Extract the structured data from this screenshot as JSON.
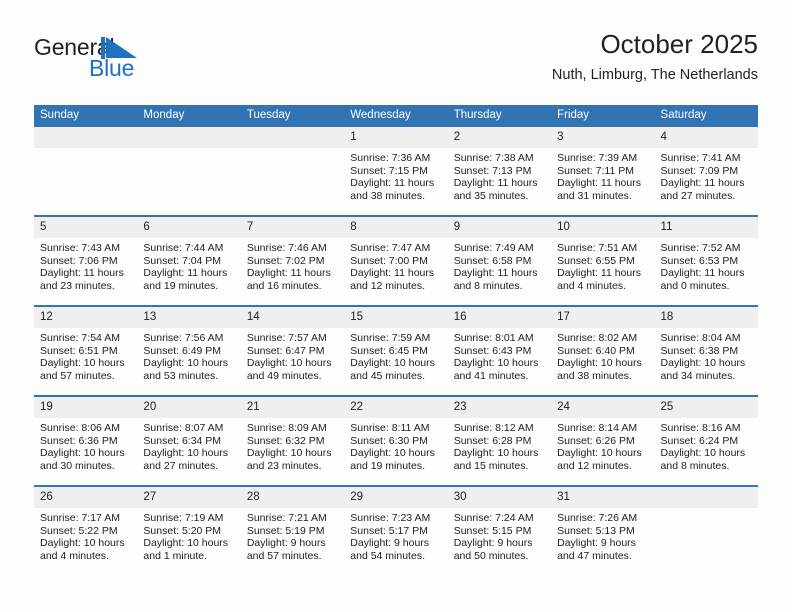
{
  "brand": {
    "name_line1": "General",
    "name_line2": "Blue",
    "flag_icon": "blue-triangle-flag-icon",
    "accent_color": "#1f72c0"
  },
  "header": {
    "title": "October 2025",
    "subtitle": "Nuth, Limburg, The Netherlands"
  },
  "theme": {
    "header_blue": "#3273b4",
    "day_number_bg": "#efefef",
    "page_bg": "#fdfdfd",
    "text": "#222222"
  },
  "weekday_headers": [
    "Sunday",
    "Monday",
    "Tuesday",
    "Wednesday",
    "Thursday",
    "Friday",
    "Saturday"
  ],
  "labels": {
    "sunrise_prefix": "Sunrise:",
    "sunset_prefix": "Sunset:",
    "daylight_prefix": "Daylight:"
  },
  "weeks": [
    [
      {
        "day": "",
        "sunrise": "",
        "sunset": "",
        "daylight": ""
      },
      {
        "day": "",
        "sunrise": "",
        "sunset": "",
        "daylight": ""
      },
      {
        "day": "",
        "sunrise": "",
        "sunset": "",
        "daylight": ""
      },
      {
        "day": "1",
        "sunrise": "Sunrise: 7:36 AM",
        "sunset": "Sunset: 7:15 PM",
        "daylight": "Daylight: 11 hours and 38 minutes."
      },
      {
        "day": "2",
        "sunrise": "Sunrise: 7:38 AM",
        "sunset": "Sunset: 7:13 PM",
        "daylight": "Daylight: 11 hours and 35 minutes."
      },
      {
        "day": "3",
        "sunrise": "Sunrise: 7:39 AM",
        "sunset": "Sunset: 7:11 PM",
        "daylight": "Daylight: 11 hours and 31 minutes."
      },
      {
        "day": "4",
        "sunrise": "Sunrise: 7:41 AM",
        "sunset": "Sunset: 7:09 PM",
        "daylight": "Daylight: 11 hours and 27 minutes."
      }
    ],
    [
      {
        "day": "5",
        "sunrise": "Sunrise: 7:43 AM",
        "sunset": "Sunset: 7:06 PM",
        "daylight": "Daylight: 11 hours and 23 minutes."
      },
      {
        "day": "6",
        "sunrise": "Sunrise: 7:44 AM",
        "sunset": "Sunset: 7:04 PM",
        "daylight": "Daylight: 11 hours and 19 minutes."
      },
      {
        "day": "7",
        "sunrise": "Sunrise: 7:46 AM",
        "sunset": "Sunset: 7:02 PM",
        "daylight": "Daylight: 11 hours and 16 minutes."
      },
      {
        "day": "8",
        "sunrise": "Sunrise: 7:47 AM",
        "sunset": "Sunset: 7:00 PM",
        "daylight": "Daylight: 11 hours and 12 minutes."
      },
      {
        "day": "9",
        "sunrise": "Sunrise: 7:49 AM",
        "sunset": "Sunset: 6:58 PM",
        "daylight": "Daylight: 11 hours and 8 minutes."
      },
      {
        "day": "10",
        "sunrise": "Sunrise: 7:51 AM",
        "sunset": "Sunset: 6:55 PM",
        "daylight": "Daylight: 11 hours and 4 minutes."
      },
      {
        "day": "11",
        "sunrise": "Sunrise: 7:52 AM",
        "sunset": "Sunset: 6:53 PM",
        "daylight": "Daylight: 11 hours and 0 minutes."
      }
    ],
    [
      {
        "day": "12",
        "sunrise": "Sunrise: 7:54 AM",
        "sunset": "Sunset: 6:51 PM",
        "daylight": "Daylight: 10 hours and 57 minutes."
      },
      {
        "day": "13",
        "sunrise": "Sunrise: 7:56 AM",
        "sunset": "Sunset: 6:49 PM",
        "daylight": "Daylight: 10 hours and 53 minutes."
      },
      {
        "day": "14",
        "sunrise": "Sunrise: 7:57 AM",
        "sunset": "Sunset: 6:47 PM",
        "daylight": "Daylight: 10 hours and 49 minutes."
      },
      {
        "day": "15",
        "sunrise": "Sunrise: 7:59 AM",
        "sunset": "Sunset: 6:45 PM",
        "daylight": "Daylight: 10 hours and 45 minutes."
      },
      {
        "day": "16",
        "sunrise": "Sunrise: 8:01 AM",
        "sunset": "Sunset: 6:43 PM",
        "daylight": "Daylight: 10 hours and 41 minutes."
      },
      {
        "day": "17",
        "sunrise": "Sunrise: 8:02 AM",
        "sunset": "Sunset: 6:40 PM",
        "daylight": "Daylight: 10 hours and 38 minutes."
      },
      {
        "day": "18",
        "sunrise": "Sunrise: 8:04 AM",
        "sunset": "Sunset: 6:38 PM",
        "daylight": "Daylight: 10 hours and 34 minutes."
      }
    ],
    [
      {
        "day": "19",
        "sunrise": "Sunrise: 8:06 AM",
        "sunset": "Sunset: 6:36 PM",
        "daylight": "Daylight: 10 hours and 30 minutes."
      },
      {
        "day": "20",
        "sunrise": "Sunrise: 8:07 AM",
        "sunset": "Sunset: 6:34 PM",
        "daylight": "Daylight: 10 hours and 27 minutes."
      },
      {
        "day": "21",
        "sunrise": "Sunrise: 8:09 AM",
        "sunset": "Sunset: 6:32 PM",
        "daylight": "Daylight: 10 hours and 23 minutes."
      },
      {
        "day": "22",
        "sunrise": "Sunrise: 8:11 AM",
        "sunset": "Sunset: 6:30 PM",
        "daylight": "Daylight: 10 hours and 19 minutes."
      },
      {
        "day": "23",
        "sunrise": "Sunrise: 8:12 AM",
        "sunset": "Sunset: 6:28 PM",
        "daylight": "Daylight: 10 hours and 15 minutes."
      },
      {
        "day": "24",
        "sunrise": "Sunrise: 8:14 AM",
        "sunset": "Sunset: 6:26 PM",
        "daylight": "Daylight: 10 hours and 12 minutes."
      },
      {
        "day": "25",
        "sunrise": "Sunrise: 8:16 AM",
        "sunset": "Sunset: 6:24 PM",
        "daylight": "Daylight: 10 hours and 8 minutes."
      }
    ],
    [
      {
        "day": "26",
        "sunrise": "Sunrise: 7:17 AM",
        "sunset": "Sunset: 5:22 PM",
        "daylight": "Daylight: 10 hours and 4 minutes."
      },
      {
        "day": "27",
        "sunrise": "Sunrise: 7:19 AM",
        "sunset": "Sunset: 5:20 PM",
        "daylight": "Daylight: 10 hours and 1 minute."
      },
      {
        "day": "28",
        "sunrise": "Sunrise: 7:21 AM",
        "sunset": "Sunset: 5:19 PM",
        "daylight": "Daylight: 9 hours and 57 minutes."
      },
      {
        "day": "29",
        "sunrise": "Sunrise: 7:23 AM",
        "sunset": "Sunset: 5:17 PM",
        "daylight": "Daylight: 9 hours and 54 minutes."
      },
      {
        "day": "30",
        "sunrise": "Sunrise: 7:24 AM",
        "sunset": "Sunset: 5:15 PM",
        "daylight": "Daylight: 9 hours and 50 minutes."
      },
      {
        "day": "31",
        "sunrise": "Sunrise: 7:26 AM",
        "sunset": "Sunset: 5:13 PM",
        "daylight": "Daylight: 9 hours and 47 minutes."
      },
      {
        "day": "",
        "sunrise": "",
        "sunset": "",
        "daylight": ""
      }
    ]
  ]
}
